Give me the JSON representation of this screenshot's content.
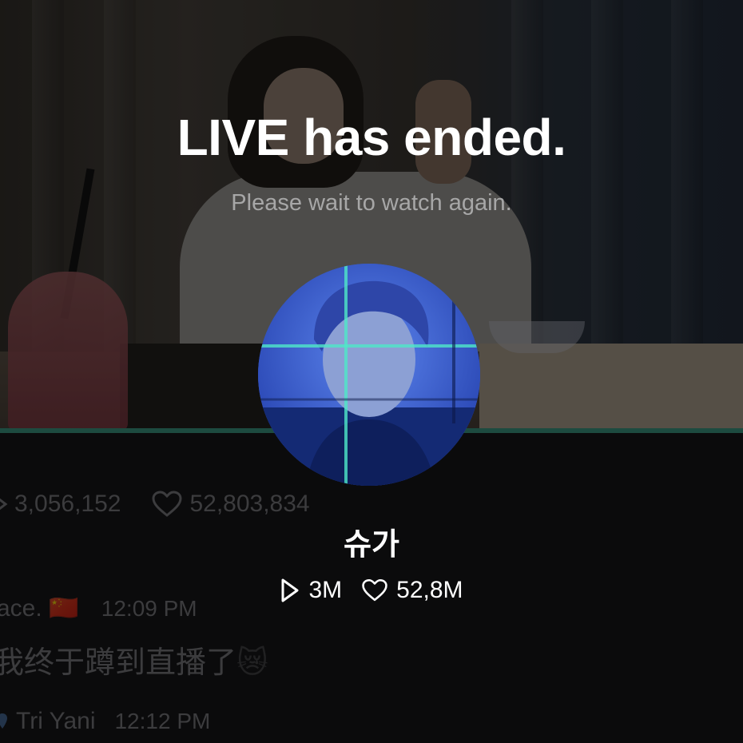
{
  "overlay": {
    "title": "LIVE has ended.",
    "subtitle": "Please wait to watch again."
  },
  "profile": {
    "name": "슈가",
    "plays": "3M",
    "likes": "52,8M"
  },
  "background_stats": {
    "plays": "3,056,152",
    "likes": "52,803,834"
  },
  "comments": [
    {
      "user": "ace.",
      "flag": "🇨🇳",
      "time": "12:09 PM",
      "text": "我终于蹲到直播了",
      "emoji": "😿"
    },
    {
      "user": "Tri Yani",
      "time": "12:12 PM"
    }
  ],
  "colors": {
    "accent": "#1d4b40",
    "background": "#0b0b0c"
  },
  "icons": [
    "play-icon",
    "heart-icon",
    "location-pin-icon"
  ]
}
